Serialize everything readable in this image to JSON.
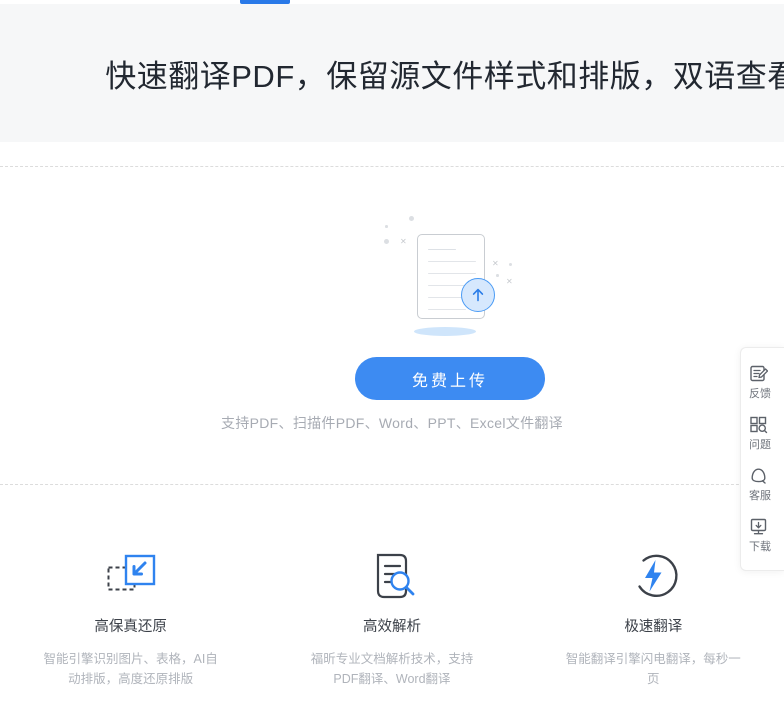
{
  "theme": {
    "accent": "#2979e8",
    "button_bg": "#3d8bf2",
    "hero_bg": "#f6f7f8",
    "title_color": "#222831",
    "muted_text": "#b0b4bb",
    "icon_blue": "#3d8bf2",
    "icon_dark": "#3c4149"
  },
  "top_accent": {
    "name": "active-tab-indicator"
  },
  "hero": {
    "title": "快速翻译PDF，保留源文件样式和排版，双语查看"
  },
  "upload": {
    "illustration": {
      "document_icon": "document-icon",
      "upload_arrow_icon": "upload-arrow-icon",
      "decorations": [
        "dot",
        "dot",
        "dot",
        "x-mark",
        "x-mark",
        "x-mark",
        "dot",
        "dot"
      ]
    },
    "button_label": "免费上传",
    "note": "支持PDF、扫描件PDF、Word、PPT、Excel文件翻译"
  },
  "features": [
    {
      "icon": "restore-fidelity-icon",
      "title": "高保真还原",
      "desc": "智能引擎识别图片、表格，AI自动排版，高度还原排版"
    },
    {
      "icon": "document-search-icon",
      "title": "高效解析",
      "desc": "福昕专业文档解析技术，支持PDF翻译、Word翻译"
    },
    {
      "icon": "lightning-icon",
      "title": "极速翻译",
      "desc": "智能翻译引擎闪电翻译，每秒一页"
    }
  ],
  "right_rail": [
    {
      "icon": "feedback-icon",
      "label": "反馈"
    },
    {
      "icon": "questions-icon",
      "label": "问题"
    },
    {
      "icon": "support-icon",
      "label": "客服"
    },
    {
      "icon": "download-icon",
      "label": "下载"
    }
  ]
}
